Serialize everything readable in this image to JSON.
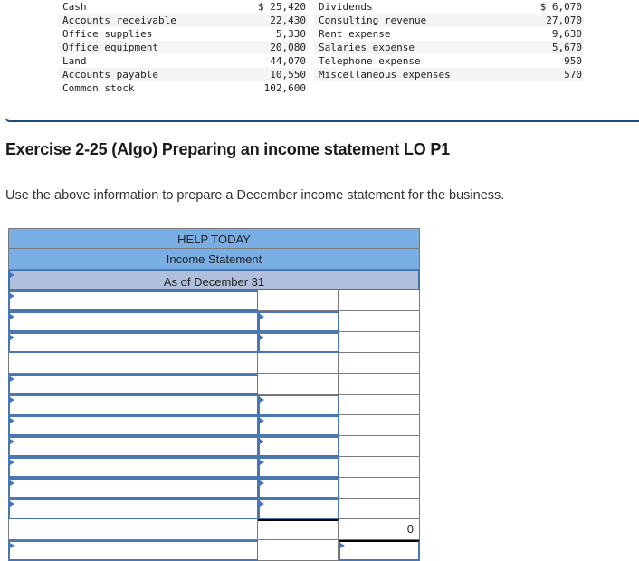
{
  "accounts_left": [
    {
      "label": "Cash",
      "value": "$ 25,420"
    },
    {
      "label": "Accounts receivable",
      "value": "22,430"
    },
    {
      "label": "Office supplies",
      "value": "5,330"
    },
    {
      "label": "Office equipment",
      "value": "20,080"
    },
    {
      "label": "Land",
      "value": "44,070"
    },
    {
      "label": "Accounts payable",
      "value": "10,550"
    },
    {
      "label": "Common stock",
      "value": "102,600"
    }
  ],
  "accounts_right": [
    {
      "label": "Dividends",
      "value": "$ 6,070"
    },
    {
      "label": "Consulting revenue",
      "value": "27,070"
    },
    {
      "label": "Rent expense",
      "value": "9,630"
    },
    {
      "label": "Salaries expense",
      "value": "5,670"
    },
    {
      "label": "Telephone expense",
      "value": "950"
    },
    {
      "label": "Miscellaneous expenses",
      "value": "570"
    }
  ],
  "exercise": {
    "title": "Exercise 2-25 (Algo) Preparing an income statement LO P1",
    "instructions": "Use the above information to prepare a December income statement for the business."
  },
  "statement": {
    "company": "HELP TODAY",
    "title": "Income Statement",
    "period": "As of December 31",
    "rows": [
      {
        "c1": "",
        "c2": "",
        "c3": ""
      },
      {
        "c1": "",
        "c2": "",
        "c3": ""
      },
      {
        "c1": "",
        "c2": "",
        "c3": ""
      },
      {
        "c1": "",
        "c2": "",
        "c3": ""
      },
      {
        "c1": "",
        "c2": "",
        "c3": ""
      },
      {
        "c1": "",
        "c2": "",
        "c3": ""
      },
      {
        "c1": "",
        "c2": "",
        "c3": ""
      },
      {
        "c1": "",
        "c2": "",
        "c3": ""
      },
      {
        "c1": "",
        "c2": "",
        "c3": ""
      },
      {
        "c1": "",
        "c2": "",
        "c3": ""
      },
      {
        "c1": "",
        "c2": "",
        "c3": ""
      },
      {
        "c1": "",
        "c2": "",
        "c3": "0"
      },
      {
        "c1": "",
        "c2": "",
        "c3": ""
      }
    ]
  },
  "colors": {
    "header_blue": "#78aee4",
    "period_row": "#b0bfdb",
    "input_border": "#4a77b0",
    "box_border": "#1f4e79"
  }
}
